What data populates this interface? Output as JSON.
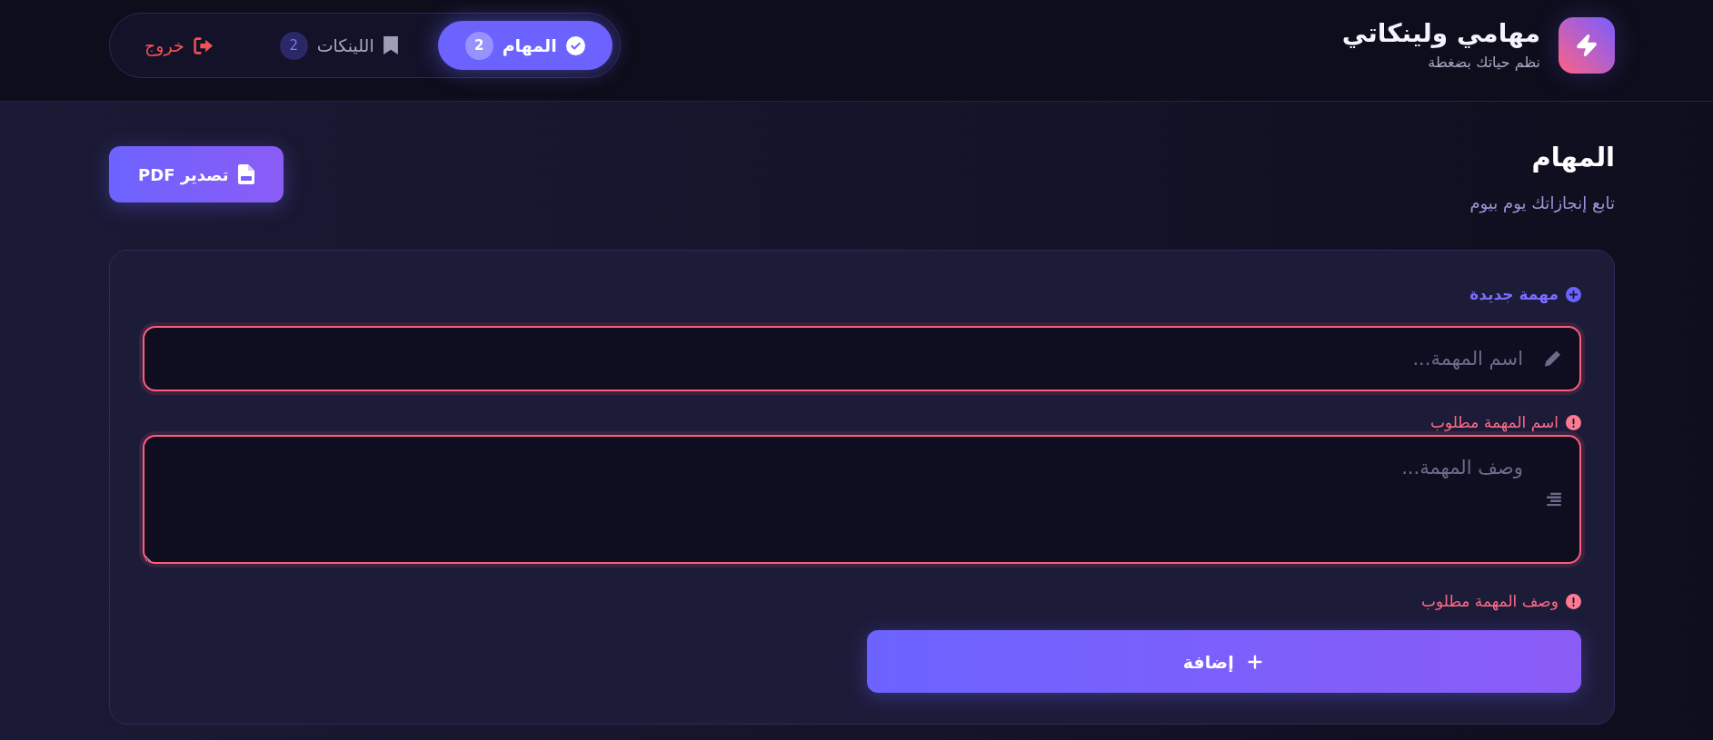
{
  "app": {
    "title": "مهامي ولينكاتي",
    "subtitle": "نظم حياتك بضغطة"
  },
  "nav": {
    "tabs": [
      {
        "kind": "tasks",
        "label": "المهام",
        "count": "2",
        "selected": true
      },
      {
        "kind": "links",
        "label": "اللينكات",
        "count": "2",
        "selected": false
      }
    ],
    "logout": {
      "label": "خروج"
    }
  },
  "page": {
    "title": "المهام",
    "subtitle": "تابع إنجازاتك يوم بيوم",
    "export_button": "تصدير PDF"
  },
  "form": {
    "heading": "مهمة جديدة",
    "fields": [
      {
        "kind": "input",
        "placeholder": "اسم المهمة...",
        "invalid": true,
        "error": "اسم المهمة مطلوب"
      },
      {
        "kind": "textarea",
        "placeholder": "وصف المهمة...",
        "invalid": true,
        "error": "وصف المهمة مطلوب"
      }
    ],
    "submit": "إضافة"
  }
}
